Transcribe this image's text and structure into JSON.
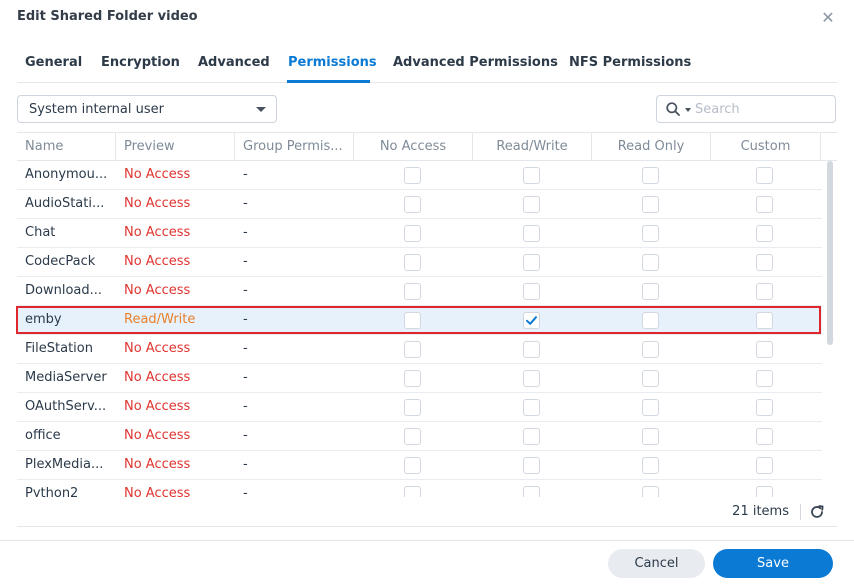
{
  "dialog": {
    "title": "Edit Shared Folder video",
    "close_icon": "close-icon"
  },
  "tabs": [
    {
      "label": "General",
      "active": false
    },
    {
      "label": "Encryption",
      "active": false
    },
    {
      "label": "Advanced",
      "active": false
    },
    {
      "label": "Permissions",
      "active": true
    },
    {
      "label": "Advanced Permissions",
      "active": false
    },
    {
      "label": "NFS Permissions",
      "active": false
    }
  ],
  "user_filter": {
    "selected": "System internal user"
  },
  "search": {
    "placeholder": "Search",
    "value": ""
  },
  "grid": {
    "columns": [
      "Name",
      "Preview",
      "Group Permis...",
      "No Access",
      "Read/Write",
      "Read Only",
      "Custom"
    ],
    "rows": [
      {
        "name": "Anonymou...",
        "preview": "No Access",
        "group": "-",
        "no_access": false,
        "read_write": false,
        "read_only": false,
        "custom": false
      },
      {
        "name": "AudioStati...",
        "preview": "No Access",
        "group": "-",
        "no_access": false,
        "read_write": false,
        "read_only": false,
        "custom": false
      },
      {
        "name": "Chat",
        "preview": "No Access",
        "group": "-",
        "no_access": false,
        "read_write": false,
        "read_only": false,
        "custom": false
      },
      {
        "name": "CodecPack",
        "preview": "No Access",
        "group": "-",
        "no_access": false,
        "read_write": false,
        "read_only": false,
        "custom": false
      },
      {
        "name": "Download...",
        "preview": "No Access",
        "group": "-",
        "no_access": false,
        "read_write": false,
        "read_only": false,
        "custom": false
      },
      {
        "name": "emby",
        "preview": "Read/Write",
        "group": "-",
        "no_access": false,
        "read_write": true,
        "read_only": false,
        "custom": false,
        "selected": true
      },
      {
        "name": "FileStation",
        "preview": "No Access",
        "group": "-",
        "no_access": false,
        "read_write": false,
        "read_only": false,
        "custom": false
      },
      {
        "name": "MediaServer",
        "preview": "No Access",
        "group": "-",
        "no_access": false,
        "read_write": false,
        "read_only": false,
        "custom": false
      },
      {
        "name": "OAuthServ...",
        "preview": "No Access",
        "group": "-",
        "no_access": false,
        "read_write": false,
        "read_only": false,
        "custom": false
      },
      {
        "name": "office",
        "preview": "No Access",
        "group": "-",
        "no_access": false,
        "read_write": false,
        "read_only": false,
        "custom": false
      },
      {
        "name": "PlexMedia...",
        "preview": "No Access",
        "group": "-",
        "no_access": false,
        "read_write": false,
        "read_only": false,
        "custom": false
      },
      {
        "name": "Python2",
        "preview": "No Access",
        "group": "-",
        "no_access": false,
        "read_write": false,
        "read_only": false,
        "custom": false
      }
    ],
    "items_count": "21 items"
  },
  "buttons": {
    "cancel": "Cancel",
    "save": "Save"
  },
  "colors": {
    "accent": "#0a7ad4",
    "no_access": "#e0342f",
    "read_write": "#e8802c",
    "highlight": "#e0262d"
  }
}
